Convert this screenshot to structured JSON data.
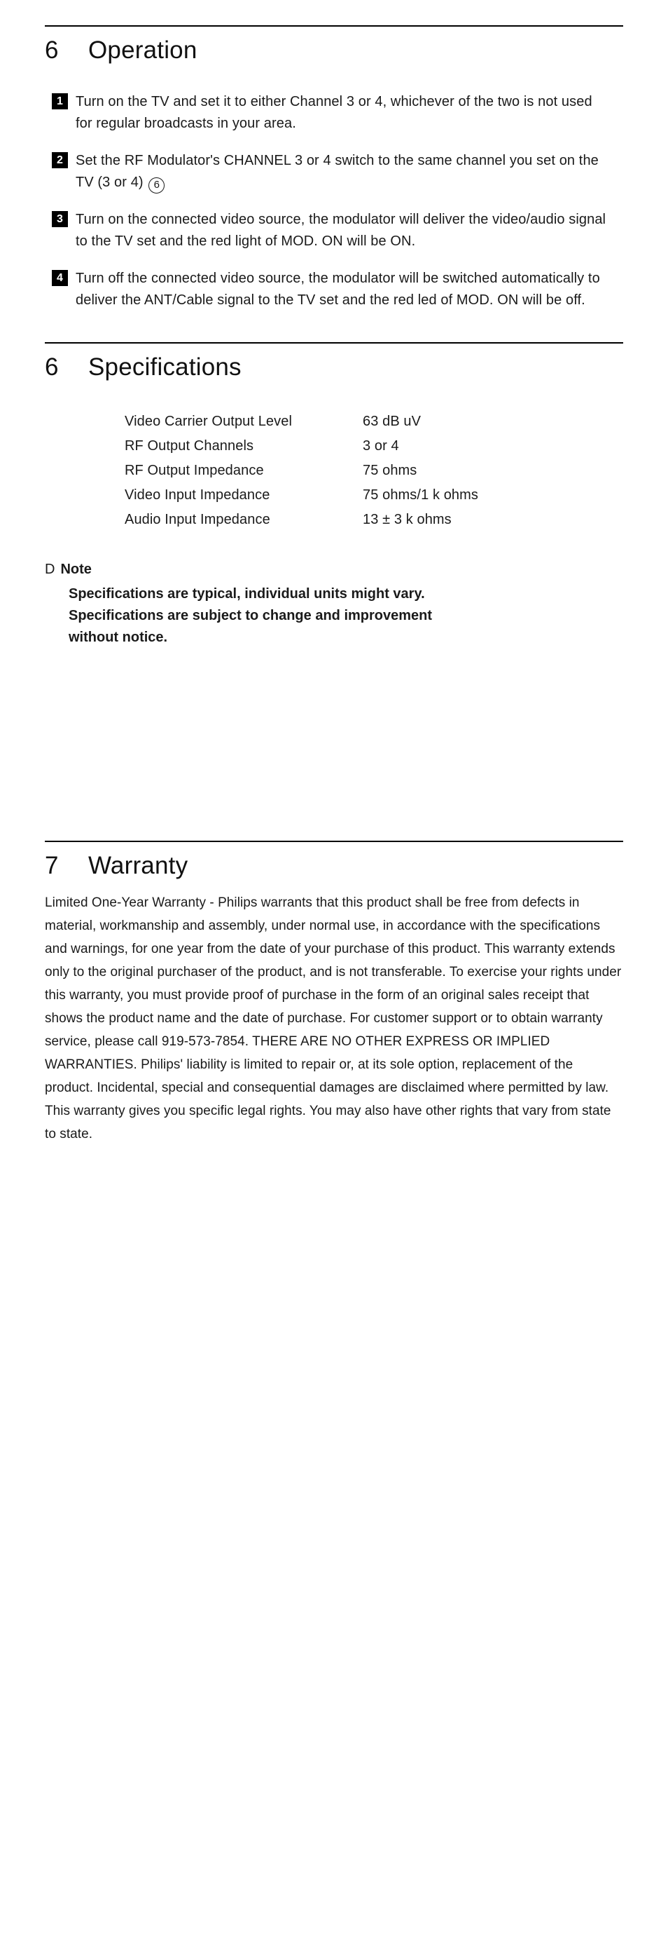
{
  "sections": {
    "operation": {
      "number": "6",
      "title": "Operation",
      "steps": [
        {
          "badge": "1",
          "text": "Turn on the TV and set it to either Channel 3 or 4, whichever of the two is not used for regular broadcasts in your area."
        },
        {
          "badge": "2",
          "text_before": "Set the RF Modulator's CHANNEL 3 or 4 switch to the same channel you set on the TV (3 or 4)",
          "circled_marker": "6",
          "text_after": ""
        },
        {
          "badge": "3",
          "text": "Turn on the connected video source, the modulator will deliver the video/audio signal to the TV set and the red light of MOD. ON will be ON."
        },
        {
          "badge": "4",
          "text": "Turn off the connected video source, the modulator will be switched automatically to deliver the ANT/Cable signal to the TV set and the red led of MOD. ON will be off."
        }
      ]
    },
    "specifications": {
      "number": "6",
      "title": "Specifications",
      "rows": [
        {
          "label": "Video Carrier Output Level",
          "value": "63 dB uV"
        },
        {
          "label": "RF Output Channels",
          "value": "3 or 4"
        },
        {
          "label": "RF Output Impedance",
          "value": "75 ohms"
        },
        {
          "label": "Video Input Impedance",
          "value": "75 ohms/1 k ohms"
        },
        {
          "label": "Audio Input Impedance",
          "value": "13 ± 3 k ohms"
        }
      ],
      "note": {
        "glyph": "D",
        "title": "Note",
        "lines": [
          "Specifications are typical, individual units might vary.",
          "Specifications are subject to change and improvement",
          "without notice."
        ]
      }
    },
    "warranty": {
      "number": "7",
      "title": "Warranty",
      "body": "Limited One-Year Warranty - Philips warrants that this product shall be free from defects in material, workmanship and assembly, under normal use, in accordance with the specifications and warnings, for one year from the date of your purchase of this product. This warranty extends only to the original purchaser of the product, and is not transferable. To exercise your rights under this warranty, you must provide proof of purchase in the form of an original sales receipt that shows the product name and the date of purchase. For customer support or to obtain warranty service, please call 919-573-7854.  THERE ARE NO OTHER EXPRESS OR IMPLIED WARRANTIES. Philips' liability is limited to repair or, at its sole option, replacement of the product.  Incidental, special and consequential damages are disclaimed where permitted by law.  This warranty gives you specific legal rights. You may also have other rights that vary from state to state."
    }
  }
}
